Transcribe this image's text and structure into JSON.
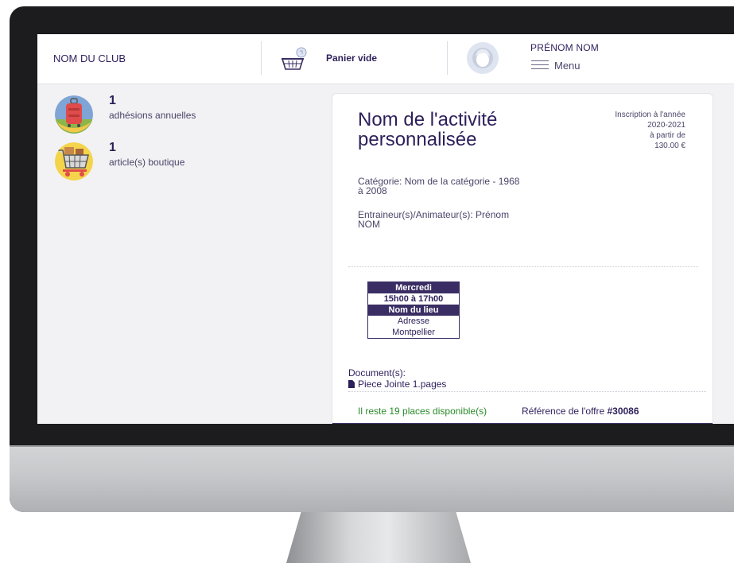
{
  "header": {
    "club_name": "NOM DU CLUB",
    "cart_label": "Panier vide",
    "user_name": "PRÉNOM NOM",
    "menu_label": "Menu"
  },
  "stats": [
    {
      "count": "1",
      "label": "adhésions annuelles",
      "icon": "luggage-icon"
    },
    {
      "count": "1",
      "label": "article(s) boutique",
      "icon": "shopping-cart-icon"
    }
  ],
  "activity": {
    "title": "Nom de l'activité personnalisée",
    "category": "Catégorie: Nom de la catégorie - 1968 à 2008",
    "coaches": "Entraineur(s)/Animateur(s): Prénom NOM",
    "price_line1": "Inscription à l'année",
    "price_line2": "2020-2021",
    "price_line3": "à partir de",
    "price_line4": "130.00 €"
  },
  "schedule": {
    "day": "Mercredi",
    "hours": "15h00 à 17h00",
    "place": "Nom du lieu",
    "address": "Adresse",
    "city": "Montpellier"
  },
  "documents": {
    "label": "Document(s):",
    "file": "Piece Jointe 1.pages"
  },
  "footer": {
    "places": "Il reste 19 places disponible(s)",
    "ref_label": "Référence de l'offre",
    "ref_number": "#30086"
  },
  "colors": {
    "brand_dark": "#3a2d63",
    "text": "#2d1f5a",
    "success": "#2a8a2a"
  }
}
